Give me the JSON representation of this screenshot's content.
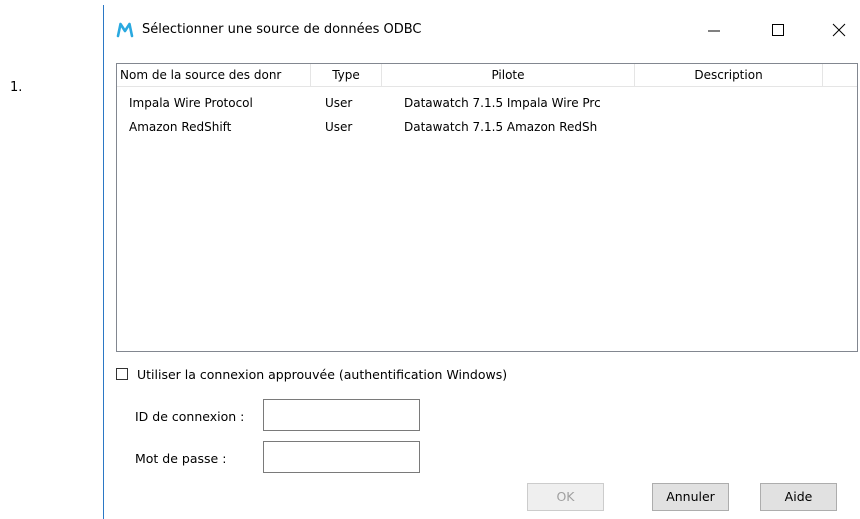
{
  "list_number": "1.",
  "dialog": {
    "title": "Sélectionner une source de données ODBC",
    "icon": "m-logo-icon",
    "accent_color": "#2b78c5",
    "window_buttons": {
      "minimize": "minimize-icon",
      "maximize": "maximize-icon",
      "close": "close-icon"
    }
  },
  "datasources": {
    "columns": [
      "Nom de la source des donr",
      "Type",
      "Pilote",
      "Description"
    ],
    "rows": [
      {
        "name": "Impala Wire Protocol",
        "type": "User",
        "driver": "Datawatch 7.1.5 Impala Wire Prc",
        "description": ""
      },
      {
        "name": "Amazon RedShift",
        "type": "User",
        "driver": "Datawatch 7.1.5 Amazon RedSh",
        "description": ""
      }
    ]
  },
  "trusted_connection": {
    "label": "Utiliser la connexion approuvée (authentification Windows)",
    "checked": false
  },
  "login": {
    "label": "ID de connexion :",
    "value": ""
  },
  "password": {
    "label": "Mot de passe :",
    "value": ""
  },
  "buttons": {
    "ok": "OK",
    "cancel": "Annuler",
    "help": "Aide"
  }
}
